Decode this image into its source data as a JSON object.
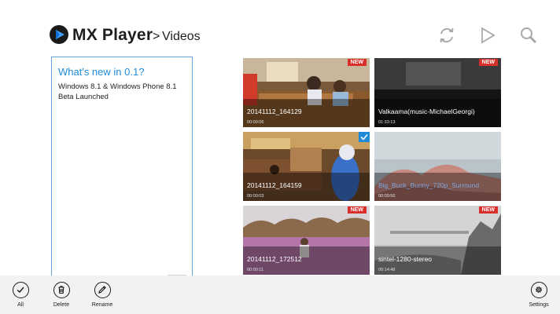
{
  "header": {
    "app_title": "MX Player",
    "breadcrumb_sep": ">",
    "page_title": "Videos",
    "icons": [
      "refresh-icon",
      "play-icon",
      "search-icon"
    ]
  },
  "news": {
    "title": "What's new in 0.1?",
    "body": "Windows 8.1 & Windows Phone 8.1 Beta Launched"
  },
  "videos": [
    {
      "name": "20141112_164129",
      "duration": "00:00:06",
      "badge": "NEW",
      "selected": false
    },
    {
      "name": "Valkaama(music-MichaelGeorgi)",
      "duration": "01:33:13",
      "badge": "NEW",
      "selected": false
    },
    {
      "name": "20141112_164159",
      "duration": "00:00:03",
      "badge": "",
      "selected": true
    },
    {
      "name": "Big_Buck_Bunny_720p_Surround",
      "duration": "00:09:56",
      "badge": "",
      "selected": false
    },
    {
      "name": "20141112_172512",
      "duration": "00:00:11",
      "badge": "NEW",
      "selected": false
    },
    {
      "name": "sintel-1280-stereo",
      "duration": "00:14:48",
      "badge": "NEW",
      "selected": false
    }
  ],
  "appbar": {
    "all_label": "All",
    "delete_label": "Delete",
    "rename_label": "Rename",
    "settings_label": "Settings"
  },
  "colors": {
    "accent": "#1f8ad8",
    "badge": "#d9302c",
    "appbar_bg": "#f2f2f2"
  }
}
